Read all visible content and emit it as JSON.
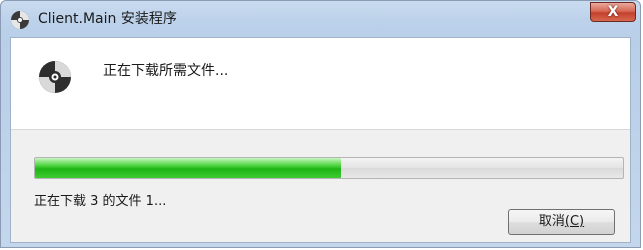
{
  "window": {
    "title": "Client.Main 安装程序",
    "close_label": "X"
  },
  "header": {
    "status": "正在下载所需文件..."
  },
  "progress": {
    "fraction": 0.52,
    "fill_color": "#2ec423"
  },
  "detail": {
    "text": "正在下载 3 的文件 1..."
  },
  "buttons": {
    "cancel_label": "取消",
    "cancel_access_key": "(C)"
  },
  "icons": {
    "app": "disc-installer-icon",
    "header": "disc-icon"
  }
}
